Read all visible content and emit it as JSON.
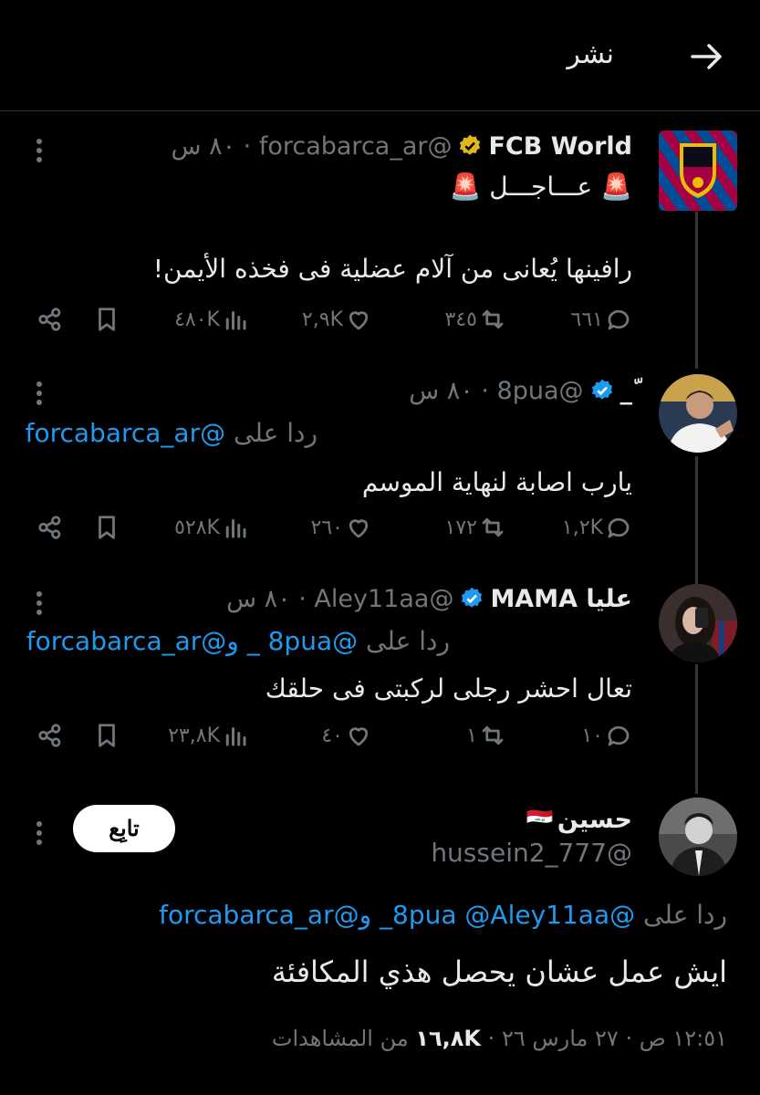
{
  "header": {
    "title": "نشر",
    "back_icon": "arrow-right-icon"
  },
  "tweets": [
    {
      "name": "FCB World",
      "verified": "gold",
      "handle": "@forcabarca_ar",
      "time": "٨٠ س",
      "line1": "🚨 عـــاجـــل 🚨",
      "line2": "رافينها يُعانى من آلام عضلية فى فخذه الأيمن!",
      "stats": {
        "replies": "٦٦١",
        "retweets": "٣٤٥",
        "likes": "٢,٩K",
        "views": "٤٨٠K"
      }
    },
    {
      "name": "ّ_",
      "verified": "blue",
      "handle": "@8pua",
      "time": "٨٠ س",
      "reply_prefix": "ردا على",
      "reply_to": "@forcabarca_ar",
      "text": "يارب اصابة لنهاية الموسم",
      "stats": {
        "replies": "١,٢K",
        "retweets": "١٧٢",
        "likes": "٢٦٠",
        "views": "٥٢٨K"
      }
    },
    {
      "name": "عليا MAMA",
      "verified": "blue",
      "handle": "@Aley11aa",
      "time": "٨٠ س",
      "reply_prefix": "ردا على",
      "reply_to_1": "@8pua",
      "reply_to_2": "_ و@forcabarca_ar",
      "text": "تعال احشر رجلى لركبتى فى حلقك",
      "stats": {
        "replies": "١٠",
        "retweets": "١",
        "likes": "٤٠",
        "views": "٢٣,٨K"
      }
    }
  ],
  "main_tweet": {
    "name": "حسين",
    "flag": "🇮🇶",
    "handle": "@hussein2_777",
    "follow_label": "تابِع",
    "reply_prefix": "ردا على",
    "reply_to": "@8pua @Aley11aa_ و@forcabarca_ar",
    "text": "ايش  عمل عشان يحصل هذي المكافئة",
    "meta_time": "١٢:٥١ ص · ٢٧ مارس ٢٦ ·",
    "meta_views": "١٦,٨K",
    "meta_views_label": "من المشاهدات"
  },
  "colors": {
    "background": "#000000",
    "text": "#e7e9ea",
    "secondary": "#71767b",
    "accent": "#1d9bf0",
    "gold": "#e2b719"
  }
}
